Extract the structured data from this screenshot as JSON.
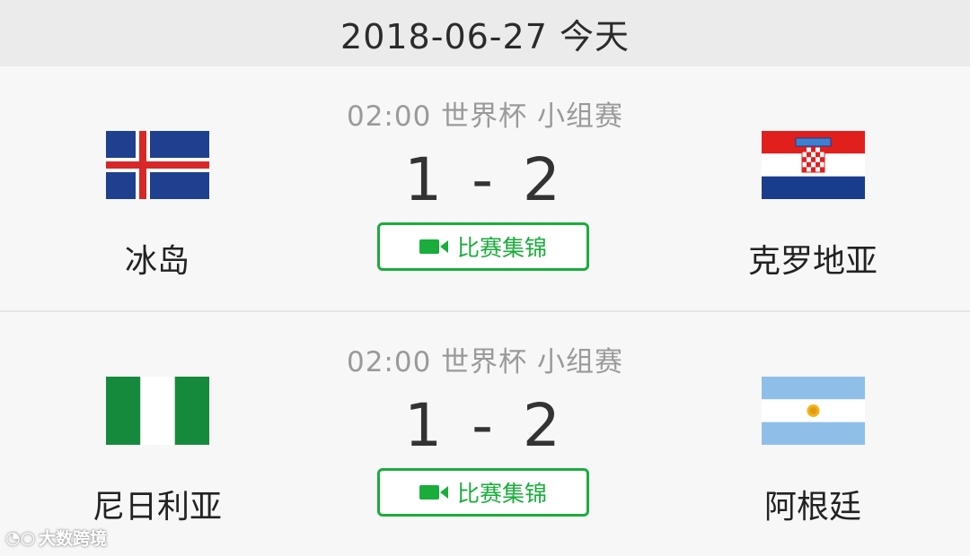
{
  "date_header": "2018-06-27 今天",
  "matches": [
    {
      "meta": "02:00 世界杯 小组赛",
      "score": "1 - 2",
      "highlights_label": "比赛集锦",
      "home": {
        "name": "冰岛",
        "flag": "iceland-flag"
      },
      "away": {
        "name": "克罗地亚",
        "flag": "croatia-flag"
      }
    },
    {
      "meta": "02:00 世界杯 小组赛",
      "score": "1 - 2",
      "highlights_label": "比赛集锦",
      "home": {
        "name": "尼日利亚",
        "flag": "nigeria-flag"
      },
      "away": {
        "name": "阿根廷",
        "flag": "argentina-flag"
      }
    }
  ],
  "watermark": "大数跨境",
  "colors": {
    "accent_green": "#1aad3c",
    "header_bg": "#ebebeb",
    "card_bg": "#f7f7f7"
  }
}
